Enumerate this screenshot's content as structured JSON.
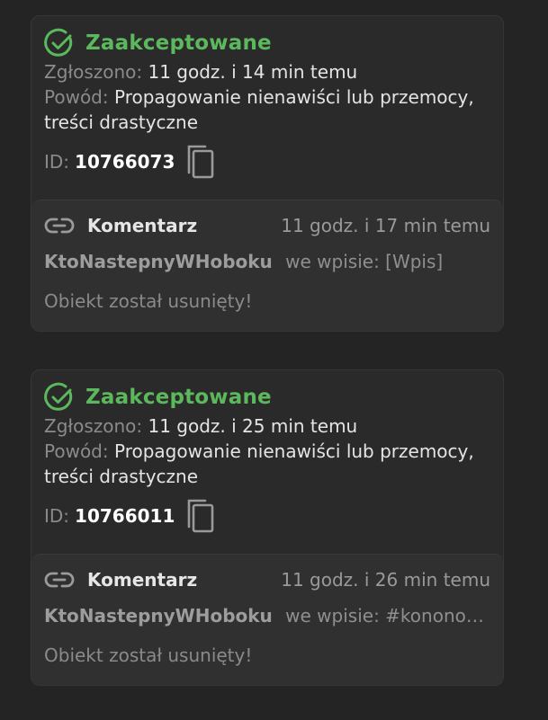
{
  "reports": [
    {
      "status": "Zaakceptowane",
      "reported_label": "Zgłoszono:",
      "reported_value": "11 godz. i 14 min temu",
      "reason_label": "Powód:",
      "reason_value": "Propagowanie nienawiści lub przemocy, treści drastyczne",
      "id_label": "ID:",
      "id_value": "10766073",
      "object": {
        "type": "Komentarz",
        "time": "11 godz. i 17 min temu",
        "user": "KtoNastepnyWHoboku",
        "context": "we wpisie: [Wpis]",
        "message": "Obiekt został usunięty!"
      }
    },
    {
      "status": "Zaakceptowane",
      "reported_label": "Zgłoszono:",
      "reported_value": "11 godz. i 25 min temu",
      "reason_label": "Powód:",
      "reason_value": "Propagowanie nienawiści lub przemocy, treści drastyczne",
      "id_label": "ID:",
      "id_value": "10766011",
      "object": {
        "type": "Komentarz",
        "time": "11 godz. i 26 min temu",
        "user": "KtoNastepnyWHoboku",
        "context": "we wpisie: #kononowicz…",
        "message": "Obiekt został usunięty!"
      }
    }
  ],
  "colors": {
    "accepted": "#5cb85c",
    "background": "#242424",
    "card": "#2a2a2a"
  },
  "icons": {
    "status": "check-circle-icon",
    "copy": "copy-icon",
    "link": "link-icon"
  }
}
